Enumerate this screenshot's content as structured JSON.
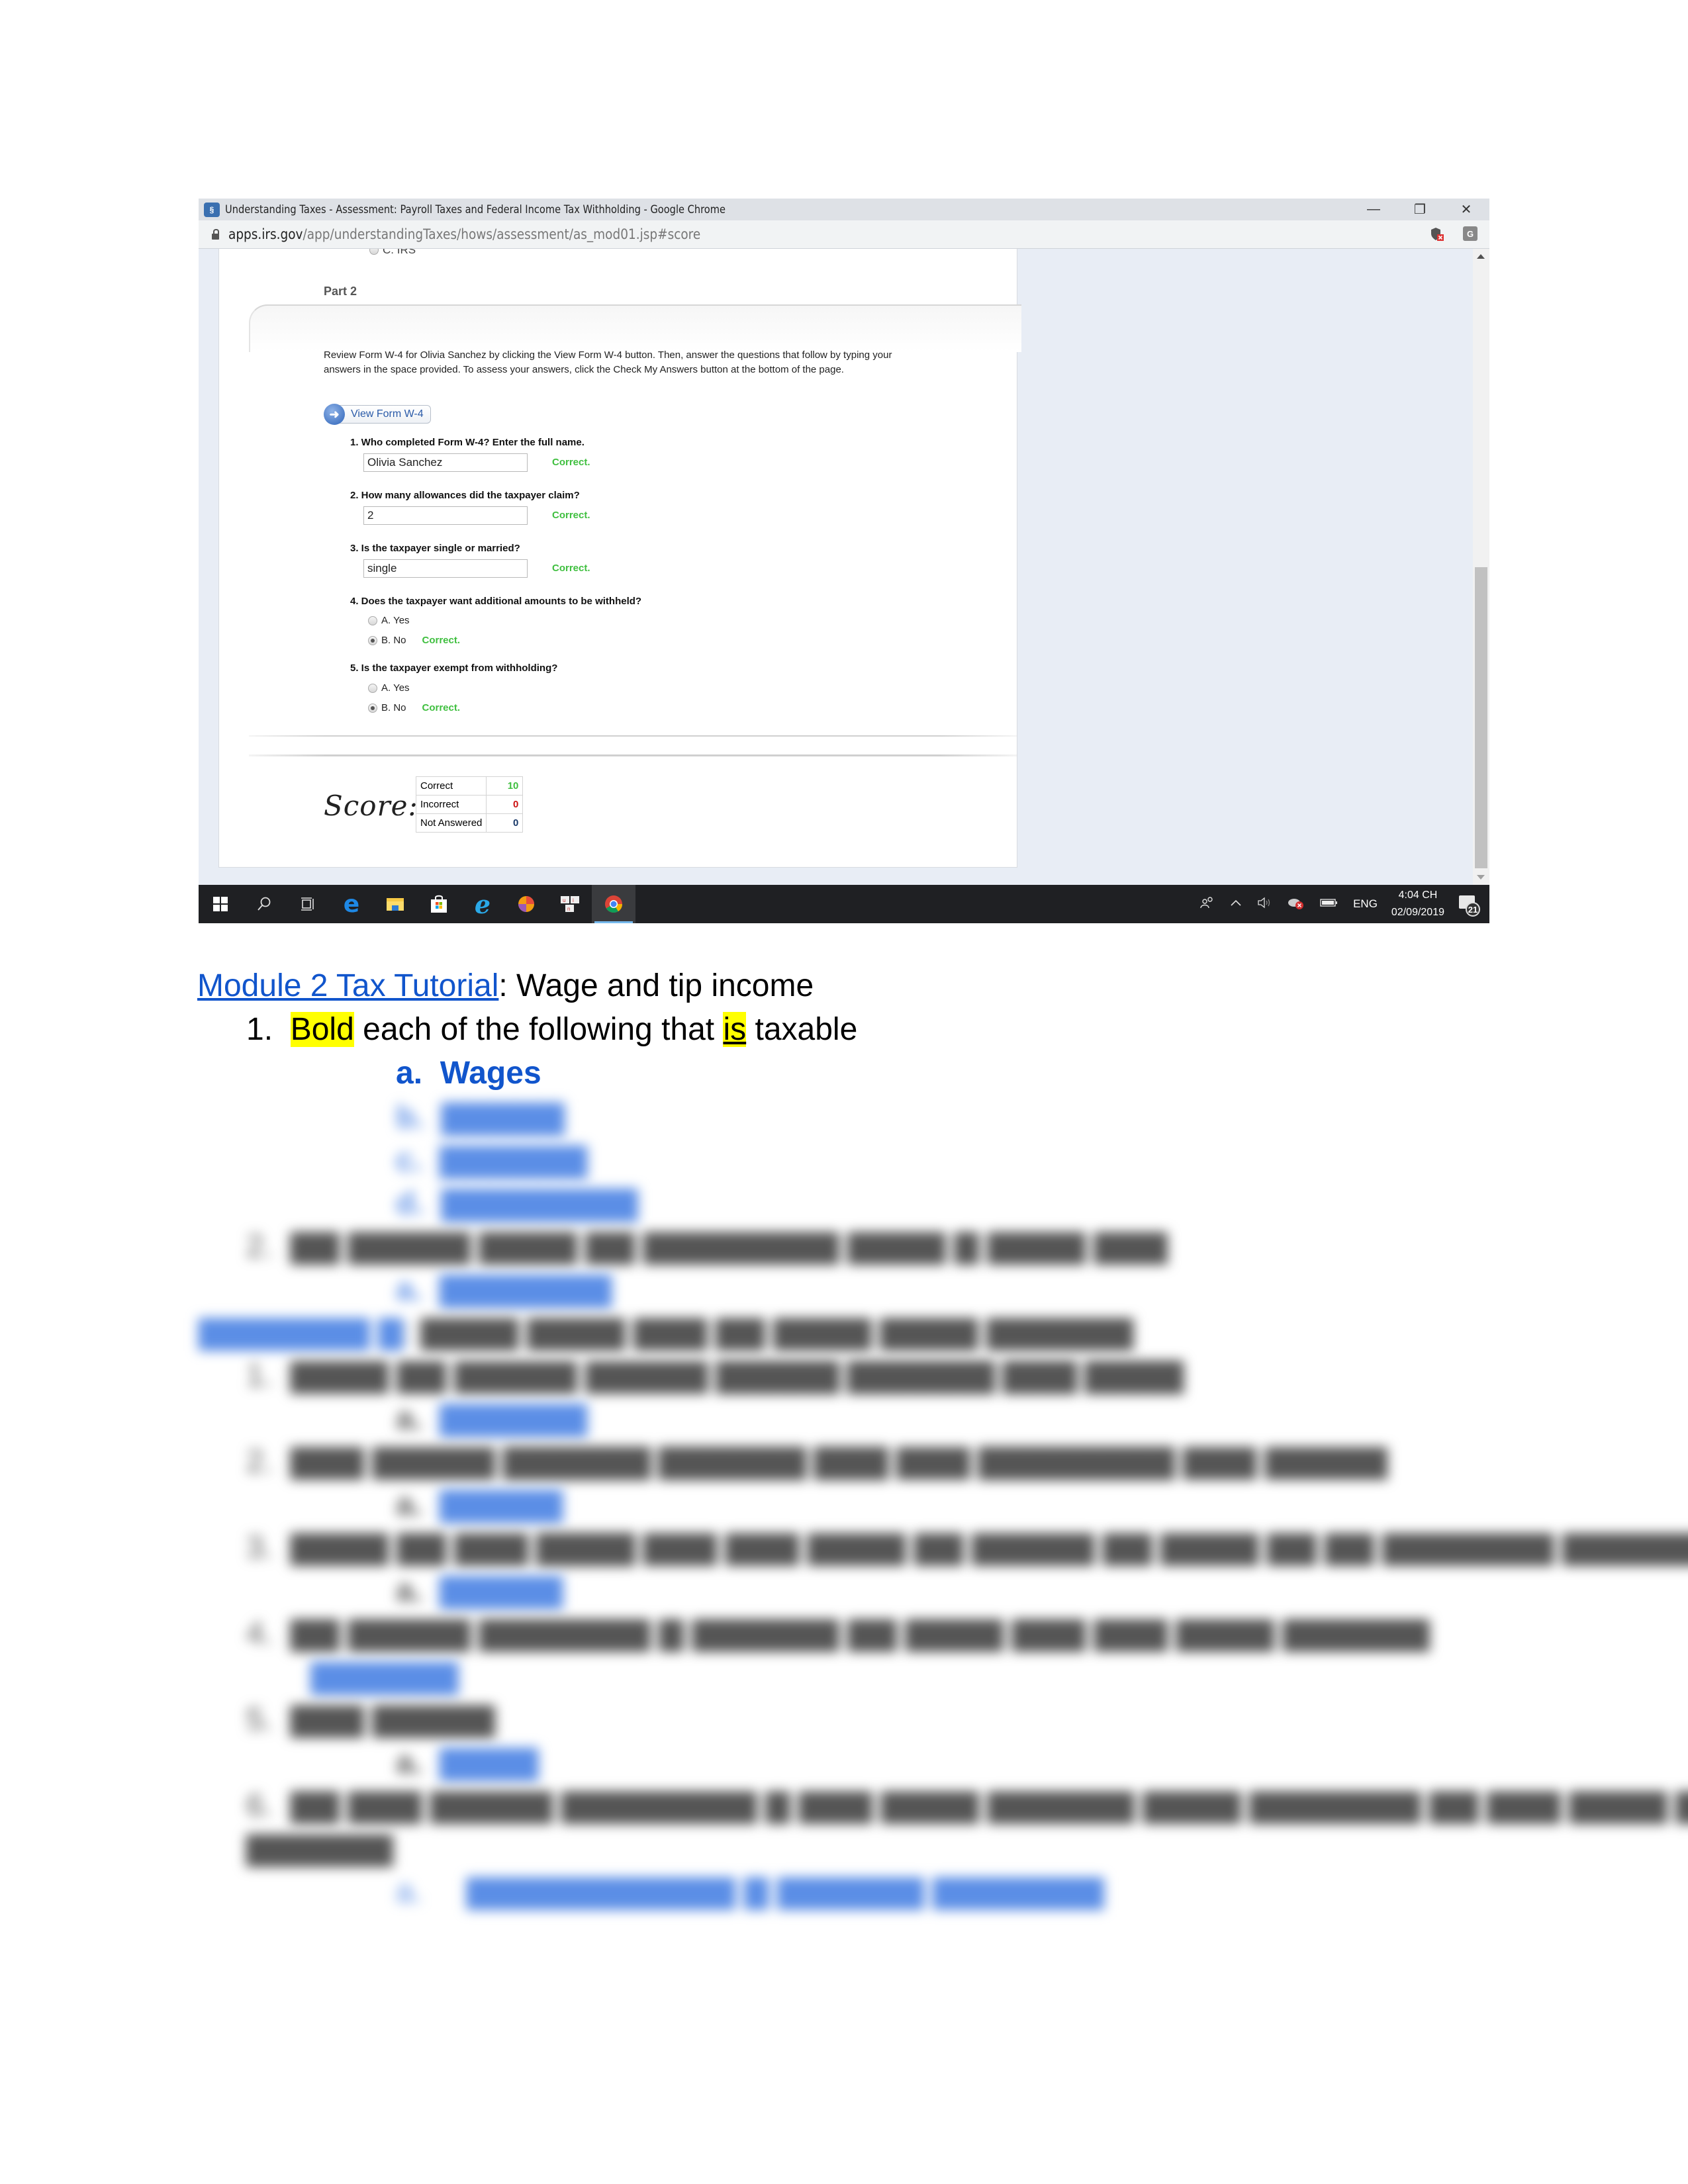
{
  "browser": {
    "window_title": "Understanding Taxes - Assessment: Payroll Taxes and Federal Income Tax Withholding - Google Chrome",
    "url_host": "apps.irs.gov",
    "url_path": "/app/understandingTaxes/hows/assessment/as_mod01.jsp#score",
    "window_controls": {
      "minimize": "—",
      "maximize": "❐",
      "close": "✕"
    },
    "extension_icons": [
      "shield-blocked-icon",
      "google-translate-icon"
    ]
  },
  "assessment": {
    "truncated_option": "C. IRS",
    "part_label": "Part 2",
    "instructions": "Review Form W-4 for Olivia Sanchez by clicking the View Form W-4 button. Then, answer the questions that follow by typing your answers in the space provided. To assess your answers, click the Check My Answers button at the bottom of the page.",
    "view_form_button": "View Form W-4",
    "questions": [
      {
        "text": "1. Who completed Form W-4? Enter the full name.",
        "answer": "Olivia Sanchez",
        "feedback": "Correct."
      },
      {
        "text": "2. How many allowances did the taxpayer claim?",
        "answer": "2",
        "feedback": "Correct."
      },
      {
        "text": "3. Is the taxpayer single or married?",
        "answer": "single",
        "feedback": "Correct."
      },
      {
        "text": "4. Does the taxpayer want additional amounts to be withheld?",
        "options": [
          "A. Yes",
          "B. No"
        ],
        "selected": "B. No",
        "feedback": "Correct."
      },
      {
        "text": "5. Is the taxpayer exempt from withholding?",
        "options": [
          "A. Yes",
          "B. No"
        ],
        "selected": "B. No",
        "feedback": "Correct."
      }
    ],
    "score": {
      "label": "Score:",
      "rows": [
        {
          "label": "Correct",
          "value": "10",
          "color": "#3fbf3f"
        },
        {
          "label": "Incorrect",
          "value": "0",
          "color": "#cc1111"
        },
        {
          "label": "Not Answered",
          "value": "0",
          "color": "#1a3a6a"
        }
      ]
    }
  },
  "taskbar": {
    "pinned": [
      "windows-start-icon",
      "search-icon",
      "task-view-icon",
      "edge-icon",
      "file-explorer-icon",
      "store-icon",
      "internet-explorer-icon",
      "app-icon",
      "keyboard-app-icon",
      "chrome-icon"
    ],
    "tray": {
      "language": "ENG",
      "time": "4:04 CH",
      "date": "02/09/2019",
      "notification_count": "21"
    }
  },
  "document": {
    "heading_link": "Module 2 Tax Tutorial",
    "heading_rest": ": Wage and tip income",
    "q1_number": "1.",
    "q1_bold_word": "Bold",
    "q1_mid": " each of the following that ",
    "q1_is": "is",
    "q1_end": " taxable",
    "q1_answer_letter": "a.",
    "q1_answer": "Wages",
    "obscured_note": "Remaining content is blurred and illegible"
  }
}
